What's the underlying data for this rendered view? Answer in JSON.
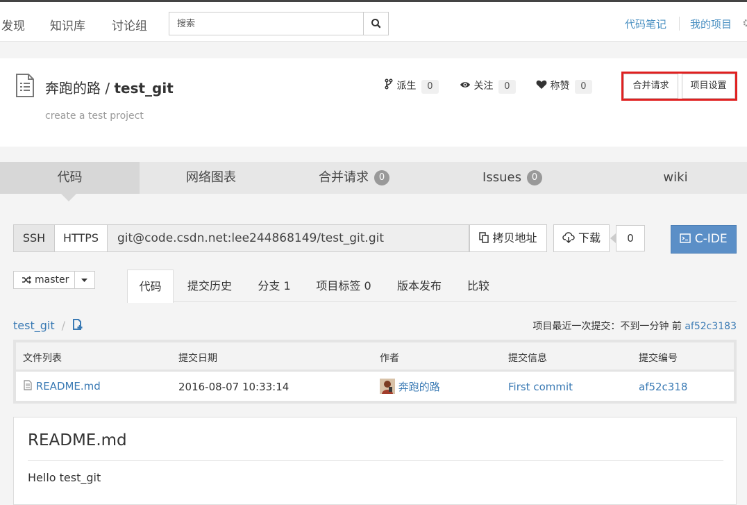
{
  "topnav": {
    "items": [
      "发现",
      "知识库",
      "讨论组"
    ],
    "search_placeholder": "搜索",
    "right_links": [
      "代码笔记",
      "我的项目"
    ]
  },
  "project": {
    "owner": "奔跑的路",
    "separator": " / ",
    "name": "test_git",
    "description": "create a test project",
    "stats": [
      {
        "label": "派生",
        "count": "0",
        "icon": "fork-icon"
      },
      {
        "label": "关注",
        "count": "0",
        "icon": "eye-icon"
      },
      {
        "label": "称赞",
        "count": "0",
        "icon": "heart-icon"
      }
    ],
    "buttons": {
      "merge": "合并请求",
      "settings": "项目设置"
    }
  },
  "main_tabs": [
    {
      "label": "代码",
      "badge": ""
    },
    {
      "label": "网络图表",
      "badge": ""
    },
    {
      "label": "合并请求",
      "badge": "0"
    },
    {
      "label": "Issues",
      "badge": "0"
    },
    {
      "label": "wiki",
      "badge": ""
    }
  ],
  "clone": {
    "ssh": "SSH",
    "https": "HTTPS",
    "url": "git@code.csdn.net:lee244868149/test_git.git",
    "copy_label": "拷贝地址",
    "download_label": "下载",
    "download_count": "0",
    "cide_label": "C-IDE"
  },
  "branch": {
    "name": "master"
  },
  "sub_tabs": [
    "代码",
    "提交历史",
    "分支 1",
    "项目标签 0",
    "版本发布",
    "比较"
  ],
  "breadcrumb": {
    "repo": "test_git",
    "sep": "/"
  },
  "last_commit": {
    "text": "项目最近一次提交：不到一分钟 前",
    "hash": "af52c3183"
  },
  "file_table": {
    "headers": [
      "文件列表",
      "提交日期",
      "作者",
      "提交信息",
      "提交编号"
    ],
    "rows": [
      {
        "file": "README.md",
        "date": "2016-08-07 10:33:14",
        "author": "奔跑的路",
        "message": "First commit",
        "hash": "af52c318"
      }
    ]
  },
  "readme": {
    "title": "README.md",
    "content": "Hello test_git"
  },
  "colors": {
    "accent": "#3a7ab4",
    "highlight": "#e02020",
    "cide": "#5b8fc7"
  }
}
